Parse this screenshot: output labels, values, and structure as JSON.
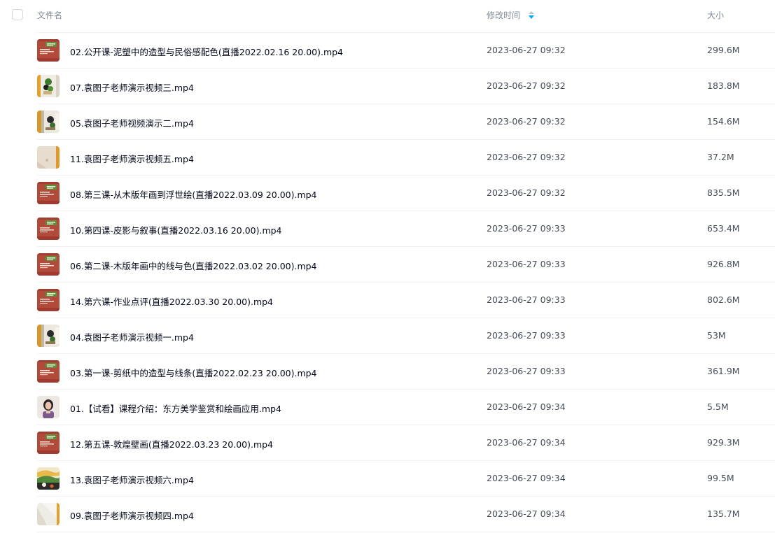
{
  "header": {
    "name_label": "文件名",
    "time_label": "修改时间",
    "size_label": "大小"
  },
  "files": [
    {
      "name": "02.公开课-泥塑中的造型与民俗感配色(直播2022.02.16 20.00).mp4",
      "time": "2023-06-27 09:32",
      "size": "299.6M",
      "thumb": "course-red"
    },
    {
      "name": "07.袁图子老师演示视频三.mp4",
      "time": "2023-06-27 09:32",
      "size": "183.8M",
      "thumb": "painting-green"
    },
    {
      "name": "05.袁图子老师视频演示二.mp4",
      "time": "2023-06-27 09:32",
      "size": "154.6M",
      "thumb": "painting-dark"
    },
    {
      "name": "11.袁图子老师演示视频五.mp4",
      "time": "2023-06-27 09:32",
      "size": "37.2M",
      "thumb": "paper-beige"
    },
    {
      "name": "08.第三课-从木版年画到浮世绘(直播2022.03.09 20.00).mp4",
      "time": "2023-06-27 09:32",
      "size": "835.5M",
      "thumb": "course-red"
    },
    {
      "name": "10.第四课-皮影与叙事(直播2022.03.16 20.00).mp4",
      "time": "2023-06-27 09:33",
      "size": "653.4M",
      "thumb": "course-red"
    },
    {
      "name": "06.第二课-木版年画中的线与色(直播2022.03.02 20.00).mp4",
      "time": "2023-06-27 09:33",
      "size": "926.8M",
      "thumb": "course-red"
    },
    {
      "name": "14.第六课-作业点评(直播2022.03.30 20.00).mp4",
      "time": "2023-06-27 09:33",
      "size": "802.6M",
      "thumb": "course-red"
    },
    {
      "name": "04.袁图子老师演示视频一.mp4",
      "time": "2023-06-27 09:33",
      "size": "53M",
      "thumb": "painting-dark"
    },
    {
      "name": "03.第一课-剪纸中的造型与线条(直播2022.02.23 20.00).mp4",
      "time": "2023-06-27 09:33",
      "size": "361.9M",
      "thumb": "course-red"
    },
    {
      "name": "01.【试看】课程介绍：东方美学鉴赏和绘画应用.mp4",
      "time": "2023-06-27 09:34",
      "size": "5.5M",
      "thumb": "portrait"
    },
    {
      "name": "12.第五课-敦煌壁画(直播2022.03.23 20.00).mp4",
      "time": "2023-06-27 09:34",
      "size": "929.3M",
      "thumb": "course-red"
    },
    {
      "name": "13.袁图子老师演示视频六.mp4",
      "time": "2023-06-27 09:34",
      "size": "99.5M",
      "thumb": "painting-landscape"
    },
    {
      "name": "09.袁图子老师演示视频四.mp4",
      "time": "2023-06-27 09:34",
      "size": "135.7M",
      "thumb": "paper-white"
    }
  ],
  "colors": {
    "sort_active": "#06a7ff",
    "course_red": "#b5483a",
    "course_green": "#6a9b3a"
  }
}
